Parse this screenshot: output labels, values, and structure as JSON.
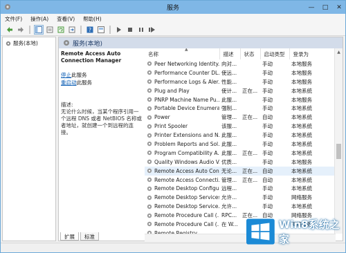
{
  "window": {
    "title": "服务"
  },
  "menu": [
    "文件(F)",
    "操作(A)",
    "查看(V)",
    "帮助(H)"
  ],
  "tree": {
    "node": "服务(本地)"
  },
  "panel": {
    "header": "服务(本地)"
  },
  "detail": {
    "service_name": "Remote Access Auto Connection Manager",
    "stop_link": "停止",
    "stop_suffix": "此服务",
    "restart_link": "重启动",
    "restart_suffix": "此服务",
    "desc_label": "描述:",
    "desc_text": "无论什么时候，当某个程序引用一个远程 DNS 或者 NetBIOS 名称或者地址，就创建一个到远程的连接。"
  },
  "columns": [
    "名称",
    "描述",
    "状态",
    "启动类型",
    "登录为"
  ],
  "rows": [
    [
      "Peer Networking Identity...",
      "向对...",
      "",
      "手动",
      "本地服务"
    ],
    [
      "Performance Counter DL...",
      "使远...",
      "",
      "手动",
      "本地服务"
    ],
    [
      "Performance Logs & Aler...",
      "性能...",
      "",
      "手动",
      "本地服务"
    ],
    [
      "Plug and Play",
      "使计...",
      "正在...",
      "手动",
      "本地系统"
    ],
    [
      "PNRP Machine Name Pu...",
      "此服...",
      "",
      "手动",
      "本地服务"
    ],
    [
      "Portable Device Enumera...",
      "强制...",
      "",
      "手动",
      "本地系统"
    ],
    [
      "Power",
      "管理...",
      "正在...",
      "自动",
      "本地系统"
    ],
    [
      "Print Spooler",
      "该服...",
      "",
      "手动",
      "本地系统"
    ],
    [
      "Printer Extensions and N...",
      "此服...",
      "",
      "手动",
      "本地系统"
    ],
    [
      "Problem Reports and Sol...",
      "此服...",
      "",
      "手动",
      "本地系统"
    ],
    [
      "Program Compatibility A...",
      "此服...",
      "正在...",
      "手动",
      "本地系统"
    ],
    [
      "Quality Windows Audio V...",
      "优质...",
      "",
      "手动",
      "本地服务"
    ],
    [
      "Remote Access Auto Con...",
      "无论...",
      "正在...",
      "自动",
      "本地系统"
    ],
    [
      "Remote Access Connecti...",
      "管理...",
      "正在...",
      "自动",
      "本地系统"
    ],
    [
      "Remote Desktop Configu...",
      "远程...",
      "",
      "手动",
      "本地系统"
    ],
    [
      "Remote Desktop Services",
      "允许...",
      "",
      "手动",
      "网络服务"
    ],
    [
      "Remote Desktop Service...",
      "允许...",
      "",
      "手动",
      "本地系统"
    ],
    [
      "Remote Procedure Call (...",
      "RPC...",
      "正在...",
      "自动",
      "网络服务"
    ],
    [
      "Remote Procedure Call (...",
      "在 W...",
      "",
      "手动",
      "网络服务"
    ],
    [
      "Remote Registry",
      "",
      "",
      "",
      ""
    ]
  ],
  "selected_row": 12,
  "tabs": [
    "扩展",
    "标准"
  ],
  "watermark": {
    "text": "Win8系统之家"
  }
}
